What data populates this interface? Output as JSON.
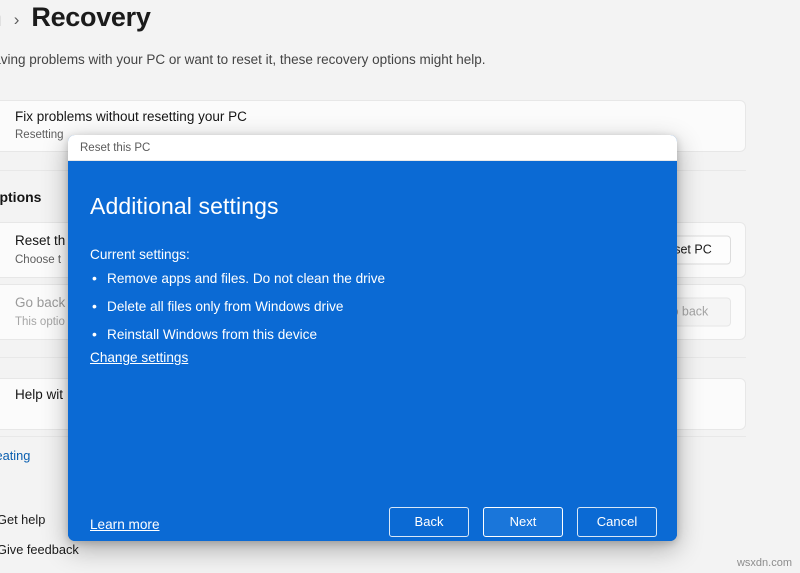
{
  "settings": {
    "breadcrumb": {
      "parent": "stem",
      "separator": "›",
      "current": "Recovery"
    },
    "description": "re having problems with your PC or want to reset it, these recovery options might help.",
    "section_heading": "ery options",
    "rows": [
      {
        "title": "Fix problems without resetting your PC",
        "subtitle": "Resetting",
        "action": "",
        "icon": "wrench-icon",
        "disabled": false
      },
      {
        "title": "Reset th",
        "subtitle": "Choose t",
        "action": "Reset PC",
        "icon": "refresh-icon",
        "disabled": false
      },
      {
        "title": "Go back",
        "subtitle": "This optio",
        "action": "Go back",
        "icon": "undo-icon",
        "disabled": true
      },
      {
        "title": "Help wit",
        "subtitle": "",
        "action": "",
        "icon": "help-icon",
        "disabled": false
      }
    ],
    "link_row": "Creating",
    "footer_links": [
      "Get help",
      "Give feedback"
    ]
  },
  "dialog": {
    "titlebar": "Reset this PC",
    "heading": "Additional settings",
    "subheading": "Current settings:",
    "bullets": [
      "Remove apps and files. Do not clean the drive",
      "Delete all files only from Windows drive",
      "Reinstall Windows from this device"
    ],
    "change_settings_link": "Change settings",
    "learn_more_link": "Learn more",
    "buttons": [
      {
        "label": "Back",
        "primary": false
      },
      {
        "label": "Next",
        "primary": true
      },
      {
        "label": "Cancel",
        "primary": false
      }
    ],
    "colors": {
      "background": "#0b6ad4",
      "primary_button_fill": "#1a76da",
      "text": "#ffffff"
    }
  },
  "watermark": "wsxdn.com"
}
